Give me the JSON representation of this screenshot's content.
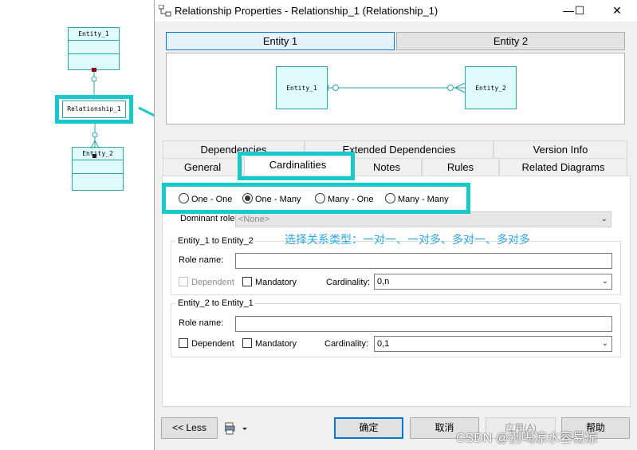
{
  "diagram": {
    "entity1": "Entity_1",
    "entity2": "Entity_2",
    "relationship": "Relationship_1"
  },
  "dialog": {
    "title": "Relationship Properties - Relationship_1 (Relationship_1)",
    "buttons": {
      "minimize": "—",
      "maximize": "☐",
      "close": "✕"
    },
    "entity_tabs": [
      "Entity 1",
      "Entity 2"
    ],
    "preview": {
      "entity1": "Entity_1",
      "entity2": "Entity_2"
    },
    "tabs_row1": [
      "Dependencies",
      "Extended Dependencies",
      "Version Info"
    ],
    "tabs_row2": [
      "General",
      "Cardinalities",
      "Notes",
      "Rules",
      "Related Diagrams"
    ],
    "cardinality_options": [
      "One - One",
      "One - Many",
      "Many - One",
      "Many - Many"
    ],
    "selected_cardinality": "One - Many",
    "dominant_role_label": "Dominant role:",
    "dominant_role_value": "<None>",
    "group1": {
      "title": "Entity_1 to Entity_2",
      "role_label": "Role name:",
      "dependent": "Dependent",
      "mandatory": "Mandatory",
      "cardinality_label": "Cardinality:",
      "cardinality_value": "0,n"
    },
    "group2": {
      "title": "Entity_2 to Entity_1",
      "role_label": "Role name:",
      "dependent": "Dependent",
      "mandatory": "Mandatory",
      "cardinality_label": "Cardinality:",
      "cardinality_value": "0,1"
    },
    "footer": {
      "less": "<< Less",
      "ok": "确定",
      "cancel": "取消",
      "apply": "应用(A)",
      "help": "帮助"
    }
  },
  "annotation": "选择关系类型：一对一、一对多、多对一、多对多",
  "watermark": "CSDN @别喝凉水容易凉",
  "colors": {
    "highlight": "#19c8c8",
    "entity_fill": "#e0fbfb",
    "entity_border": "#2aa6a6",
    "annotation": "#2aa7e0"
  }
}
